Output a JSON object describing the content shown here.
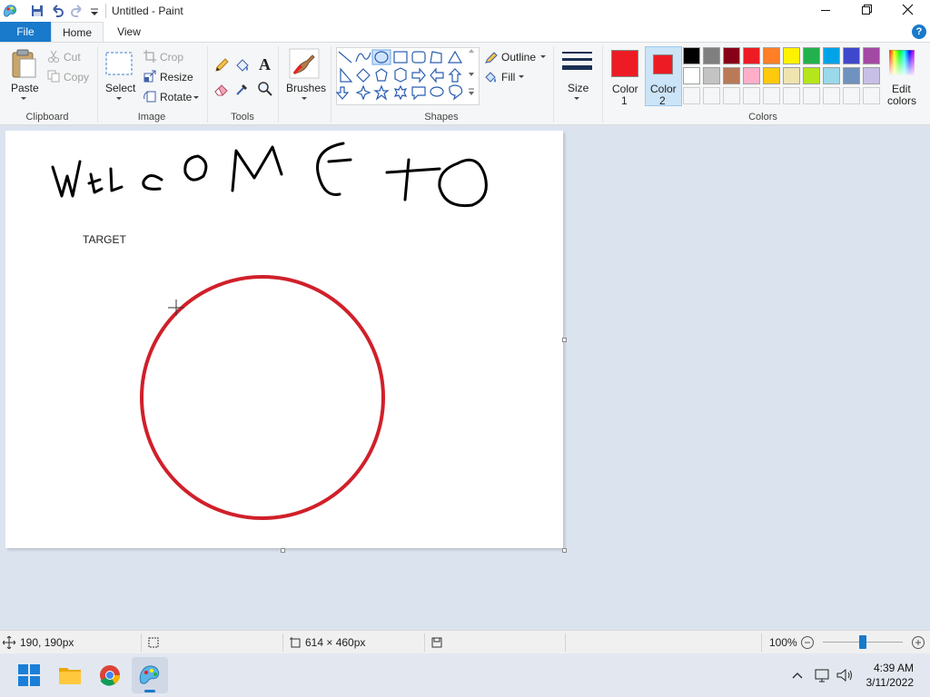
{
  "window": {
    "title": "Untitled - Paint"
  },
  "tabs": {
    "file": "File",
    "home": "Home",
    "view": "View"
  },
  "clipboard": {
    "paste": "Paste",
    "cut": "Cut",
    "copy": "Copy",
    "group": "Clipboard"
  },
  "image": {
    "select": "Select",
    "crop": "Crop",
    "resize": "Resize",
    "rotate": "Rotate",
    "group": "Image"
  },
  "tools": {
    "group": "Tools"
  },
  "brushes": {
    "label": "Brushes"
  },
  "shapes": {
    "outline": "Outline",
    "fill": "Fill",
    "group": "Shapes"
  },
  "size": {
    "label": "Size"
  },
  "colors": {
    "color1_label": "Color\n1",
    "color1_l1": "Color",
    "color1_l2": "1",
    "color2_l1": "Color",
    "color2_l2": "2",
    "edit_l1": "Edit",
    "edit_l2": "colors",
    "group": "Colors",
    "color1": "#ed1c24",
    "color2": "#ed1c24",
    "palette_row1": [
      "#000000",
      "#7f7f7f",
      "#880015",
      "#ed1c24",
      "#ff7f27",
      "#fff200",
      "#22b14c",
      "#00a2e8",
      "#3f48cc",
      "#a349a4"
    ],
    "palette_row2": [
      "#ffffff",
      "#c3c3c3",
      "#b97a57",
      "#ffaec9",
      "#ffc90e",
      "#efe4b0",
      "#b5e61d",
      "#99d9ea",
      "#7092be",
      "#c8bfe7"
    ]
  },
  "canvas": {
    "handwriting": "welcome to",
    "text": "TARGET",
    "circle_color": "#d0202a"
  },
  "status": {
    "cursor_pos": "190, 190px",
    "canvas_size": "614 × 460px",
    "zoom": "100%"
  },
  "taskbar": {
    "time": "4:39 AM",
    "date": "3/11/2022"
  }
}
